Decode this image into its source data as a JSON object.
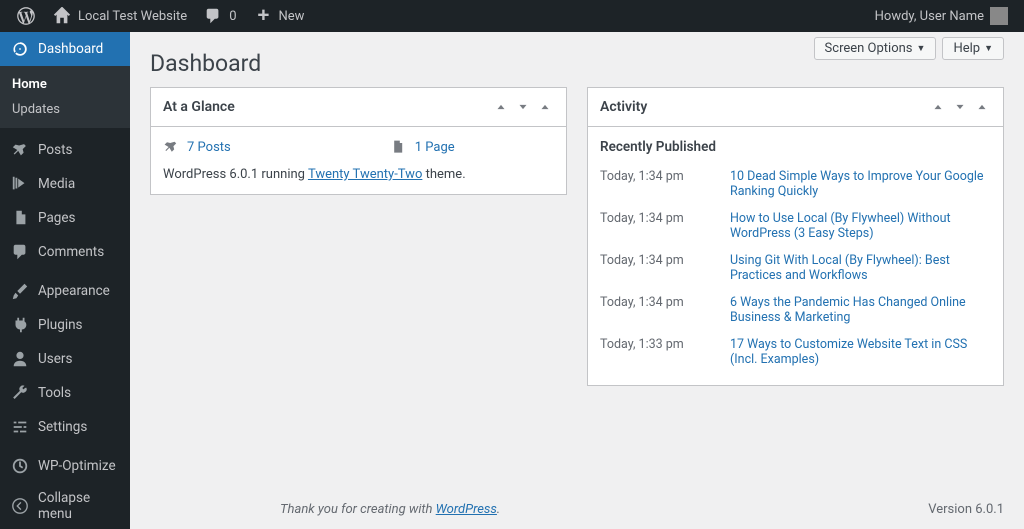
{
  "toolbar": {
    "site_name": "Local Test Website",
    "comments_count": "0",
    "new_label": "New",
    "howdy": "Howdy, User Name"
  },
  "sidebar": {
    "dashboard": "Dashboard",
    "home": "Home",
    "updates": "Updates",
    "posts": "Posts",
    "media": "Media",
    "pages": "Pages",
    "comments": "Comments",
    "appearance": "Appearance",
    "plugins": "Plugins",
    "users": "Users",
    "tools": "Tools",
    "settings": "Settings",
    "wp_optimize": "WP-Optimize",
    "collapse": "Collapse menu"
  },
  "page": {
    "title": "Dashboard",
    "screen_options": "Screen Options",
    "help": "Help"
  },
  "glance": {
    "title": "At a Glance",
    "posts": "7 Posts",
    "pages": "1 Page",
    "wp_pre": "WordPress 6.0.1 running ",
    "theme": "Twenty Twenty-Two",
    "wp_post": " theme."
  },
  "activity": {
    "title": "Activity",
    "subtitle": "Recently Published",
    "items": [
      {
        "time": "Today, 1:34 pm",
        "title": "10 Dead Simple Ways to Improve Your Google Ranking Quickly"
      },
      {
        "time": "Today, 1:34 pm",
        "title": "How to Use Local (By Flywheel) Without WordPress (3 Easy Steps)"
      },
      {
        "time": "Today, 1:34 pm",
        "title": "Using Git With Local (By Flywheel): Best Practices and Workflows"
      },
      {
        "time": "Today, 1:34 pm",
        "title": "6 Ways the Pandemic Has Changed Online Business & Marketing"
      },
      {
        "time": "Today, 1:33 pm",
        "title": "17 Ways to Customize Website Text in CSS (Incl. Examples)"
      }
    ]
  },
  "footer": {
    "thanks_pre": "Thank you for creating with ",
    "wp": "WordPress",
    "thanks_post": ".",
    "version": "Version 6.0.1"
  }
}
